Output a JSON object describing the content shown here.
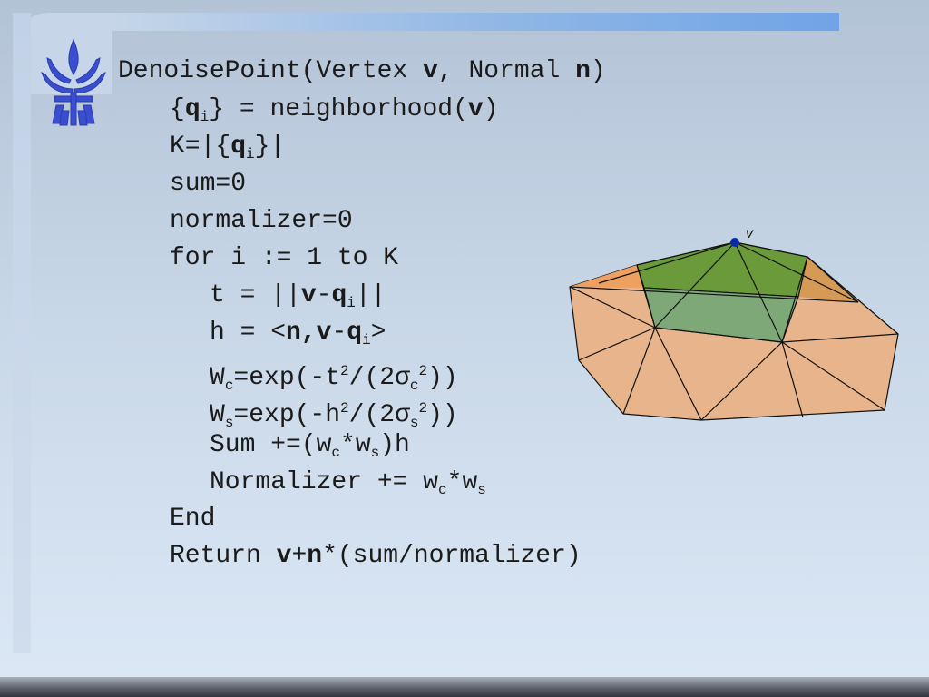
{
  "code": {
    "signature": {
      "name": "DenoisePoint(Vertex ",
      "v": "v",
      "sep": ", Normal ",
      "n": "n",
      "close": ")"
    },
    "l1": {
      "a": "{",
      "q": "q",
      "sub": "i",
      "b": "} = neighborhood(",
      "v": "v",
      "c": ")"
    },
    "l2": {
      "a": "K=|{",
      "q": "q",
      "sub": "i",
      "b": "}|"
    },
    "l3": "sum=0",
    "l4": "normalizer=0",
    "l5": "for i := 1 to K",
    "l6": {
      "a": "t = ||",
      "v": "v",
      "minus": "-",
      "q": "q",
      "sub": "i",
      "b": "||"
    },
    "l7": {
      "a": "h = <",
      "n": "n",
      "comma": ",",
      "v": "v",
      "minus": "-",
      "q": "q",
      "sub": "i",
      "b": ">"
    },
    "l8": {
      "a": "W",
      "sub1": "c",
      "b": "=exp(-t",
      "sup1": "2",
      "c": "/(2σ",
      "sub2": "c",
      "sup2": "2",
      "d": "))"
    },
    "l9": {
      "a": "W",
      "sub1": "s",
      "b": "=exp(-h",
      "sup1": "2",
      "c": "/(2σ",
      "sub2": "s",
      "sup2": "2",
      "d": "))"
    },
    "l10": {
      "a": "Sum +=(w",
      "sub1": "c",
      "b": "*w",
      "sub2": "s",
      "c": ")h"
    },
    "l11": {
      "a": "Normalizer += w",
      "sub1": "c",
      "b": "*w",
      "sub2": "s"
    },
    "l12": "End",
    "l13": {
      "a": "Return ",
      "v": "v",
      "plus": "+",
      "n": "n",
      "b": "*(sum/normalizer)"
    }
  },
  "figure": {
    "vertex_label": "v"
  },
  "colors": {
    "mesh_orange": "#e8b48c",
    "mesh_green": "#6a9a3a",
    "vertex_dot": "#0a2aa8",
    "logo_blue": "#3a4ed0"
  }
}
